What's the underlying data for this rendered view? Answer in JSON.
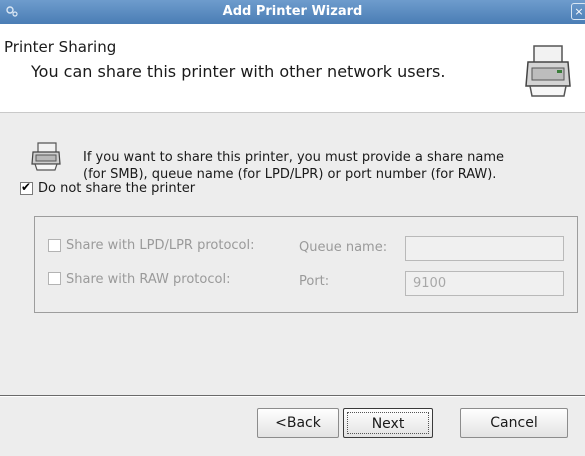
{
  "window": {
    "title": "Add Printer Wizard",
    "close_glyph": "×"
  },
  "header": {
    "title": "Printer Sharing",
    "subtitle": "You can share this printer with other network users."
  },
  "info": {
    "line1": "If you want to share this printer, you must provide a  share name",
    "line2": "(for SMB), queue name (for LPD/LPR) or port number (for RAW)."
  },
  "sharing": {
    "do_not_share_label": "Do not share the printer",
    "do_not_share_checked": true,
    "lpd": {
      "label": "Share with LPD/LPR protocol:",
      "checked": false,
      "field_label": "Queue name:",
      "value": ""
    },
    "raw": {
      "label": "Share with RAW protocol:",
      "checked": false,
      "field_label": "Port:",
      "value": "9100"
    }
  },
  "buttons": {
    "back": "<Back",
    "next": "Next",
    "cancel": "Cancel"
  },
  "colors": {
    "titlebar": "#5b8cc4",
    "header_bg": "#ffffff",
    "dialog_bg": "#ededed",
    "disabled_text": "#9a9a9a"
  }
}
